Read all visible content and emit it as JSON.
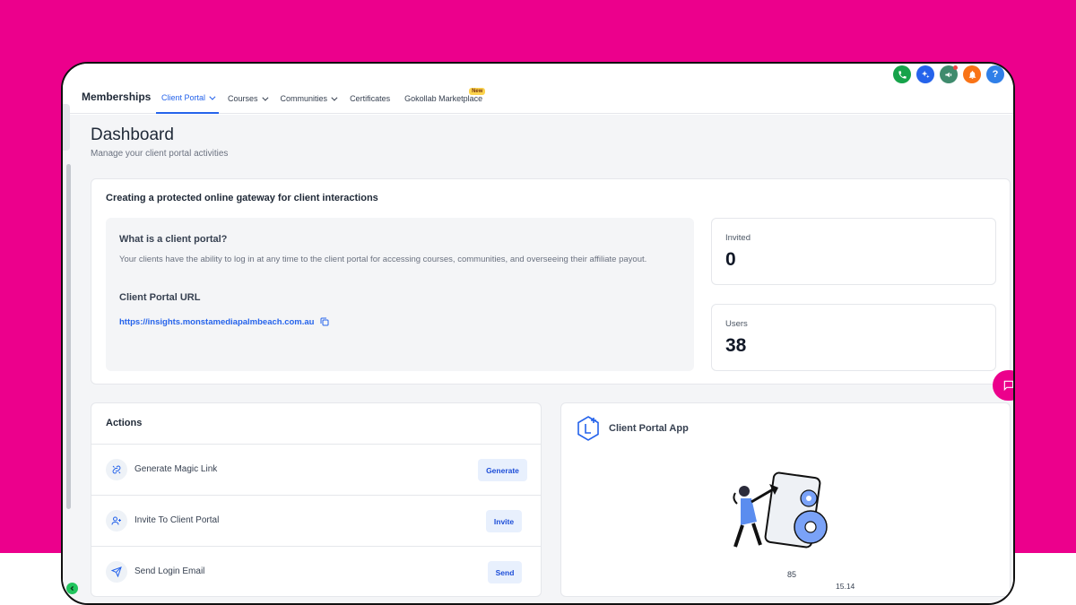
{
  "brand": "Memberships",
  "nav": [
    {
      "label": "Client Portal",
      "chevron": true,
      "active": true
    },
    {
      "label": "Courses",
      "chevron": true
    },
    {
      "label": "Communities",
      "chevron": true
    },
    {
      "label": "Certificates",
      "chevron": false
    },
    {
      "label": "Gokollab Marketplace",
      "chevron": false,
      "badge": "New"
    }
  ],
  "header_icons": [
    {
      "name": "phone-icon",
      "color": "#16a34a"
    },
    {
      "name": "sparkle-icon",
      "color": "#2563eb"
    },
    {
      "name": "megaphone-icon",
      "color": "#3f8b6d"
    },
    {
      "name": "bell-icon",
      "color": "#f97316"
    },
    {
      "name": "help-icon",
      "color": "#2f7fe8",
      "glyph": "?"
    }
  ],
  "page": {
    "title": "Dashboard",
    "subtitle": "Manage your client portal activities"
  },
  "overview": {
    "title": "Creating a protected online gateway for client interactions",
    "info_heading": "What is a client portal?",
    "info_text": "Your clients have the ability to log in at any time to the client portal for accessing courses, communities, and overseeing their affiliate payout.",
    "url_heading": "Client Portal URL",
    "url": "https://insights.monstamediapalmbeach.com.au"
  },
  "stats": [
    {
      "label": "Invited",
      "value": "0"
    },
    {
      "label": "Users",
      "value": "38"
    }
  ],
  "actions": {
    "title": "Actions",
    "items": [
      {
        "label": "Generate Magic Link",
        "button": "Generate"
      },
      {
        "label": "Invite To Client Portal",
        "button": "Invite"
      },
      {
        "label": "Send Login Email",
        "button": "Send"
      }
    ]
  },
  "app_card": {
    "title": "Client Portal App",
    "value_a": "85",
    "value_b": "15.14"
  },
  "colors": {
    "background": "#ec008c",
    "accent": "#2563eb",
    "badge": "#fcd34d"
  }
}
